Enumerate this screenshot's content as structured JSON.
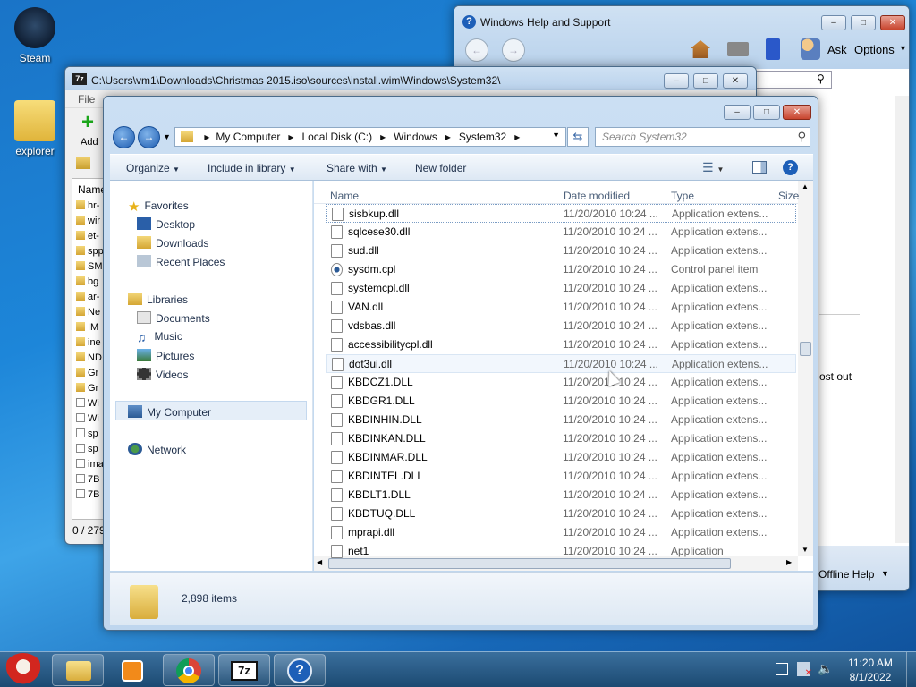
{
  "desktop": {
    "icons": [
      {
        "label": "Steam",
        "icon": "steam-icon"
      },
      {
        "label": "explorer",
        "icon": "folder-icon"
      }
    ]
  },
  "help_window": {
    "title": "Windows Help and Support",
    "ask": "Ask",
    "options": "Options",
    "partial_text": "ost out",
    "offline_help": "Offline Help"
  },
  "zip_window": {
    "title": "C:\\Users\\vm1\\Downloads\\Christmas 2015.iso\\sources\\install.wim\\Windows\\System32\\",
    "menu_file": "File",
    "add_label": "Add",
    "col_name": "Name",
    "truncated_names": [
      "hr-",
      "wir",
      "et-",
      "spp",
      "SM",
      "bg",
      "ar-",
      "Ne",
      "IM",
      "ine",
      "ND",
      "Gr",
      "Gr",
      "Wi",
      "Wi",
      "sp",
      "sp",
      "ima",
      "7B",
      "7B"
    ],
    "status": "0 / 279"
  },
  "explorer": {
    "breadcrumbs": [
      "My Computer",
      "Local Disk (C:)",
      "Windows",
      "System32"
    ],
    "search_placeholder": "Search System32",
    "commands": {
      "organize": "Organize",
      "include_in_library": "Include in library",
      "share_with": "Share with",
      "new_folder": "New folder"
    },
    "nav": {
      "favorites": "Favorites",
      "desktop": "Desktop",
      "downloads": "Downloads",
      "recent_places": "Recent Places",
      "libraries": "Libraries",
      "documents": "Documents",
      "music": "Music",
      "pictures": "Pictures",
      "videos": "Videos",
      "my_computer": "My Computer",
      "network": "Network"
    },
    "columns": {
      "name": "Name",
      "date": "Date modified",
      "type": "Type",
      "size": "Size"
    },
    "files": [
      {
        "name": "sisbkup.dll",
        "date": "11/20/2010 10:24 ...",
        "type": "Application extens..."
      },
      {
        "name": "sqlcese30.dll",
        "date": "11/20/2010 10:24 ...",
        "type": "Application extens..."
      },
      {
        "name": "sud.dll",
        "date": "11/20/2010 10:24 ...",
        "type": "Application extens..."
      },
      {
        "name": "sysdm.cpl",
        "date": "11/20/2010 10:24 ...",
        "type": "Control panel item"
      },
      {
        "name": "systemcpl.dll",
        "date": "11/20/2010 10:24 ...",
        "type": "Application extens..."
      },
      {
        "name": "VAN.dll",
        "date": "11/20/2010 10:24 ...",
        "type": "Application extens..."
      },
      {
        "name": "vdsbas.dll",
        "date": "11/20/2010 10:24 ...",
        "type": "Application extens..."
      },
      {
        "name": "accessibilitycpl.dll",
        "date": "11/20/2010 10:24 ...",
        "type": "Application extens..."
      },
      {
        "name": "dot3ui.dll",
        "date": "11/20/2010 10:24 ...",
        "type": "Application extens..."
      },
      {
        "name": "KBDCZ1.DLL",
        "date": "11/20/2010 10:24 ...",
        "type": "Application extens..."
      },
      {
        "name": "KBDGR1.DLL",
        "date": "11/20/2010 10:24 ...",
        "type": "Application extens..."
      },
      {
        "name": "KBDINHIN.DLL",
        "date": "11/20/2010 10:24 ...",
        "type": "Application extens..."
      },
      {
        "name": "KBDINKAN.DLL",
        "date": "11/20/2010 10:24 ...",
        "type": "Application extens..."
      },
      {
        "name": "KBDINMAR.DLL",
        "date": "11/20/2010 10:24 ...",
        "type": "Application extens..."
      },
      {
        "name": "KBDINTEL.DLL",
        "date": "11/20/2010 10:24 ...",
        "type": "Application extens..."
      },
      {
        "name": "KBDLT1.DLL",
        "date": "11/20/2010 10:24 ...",
        "type": "Application extens..."
      },
      {
        "name": "KBDTUQ.DLL",
        "date": "11/20/2010 10:24 ...",
        "type": "Application extens..."
      },
      {
        "name": "mprapi.dll",
        "date": "11/20/2010 10:24 ...",
        "type": "Application extens..."
      },
      {
        "name": "net1",
        "date": "11/20/2010 10:24 ...",
        "type": "Application"
      }
    ],
    "item_count": "2,898 items"
  },
  "taskbar": {
    "time": "11:20 AM",
    "date": "8/1/2022"
  }
}
